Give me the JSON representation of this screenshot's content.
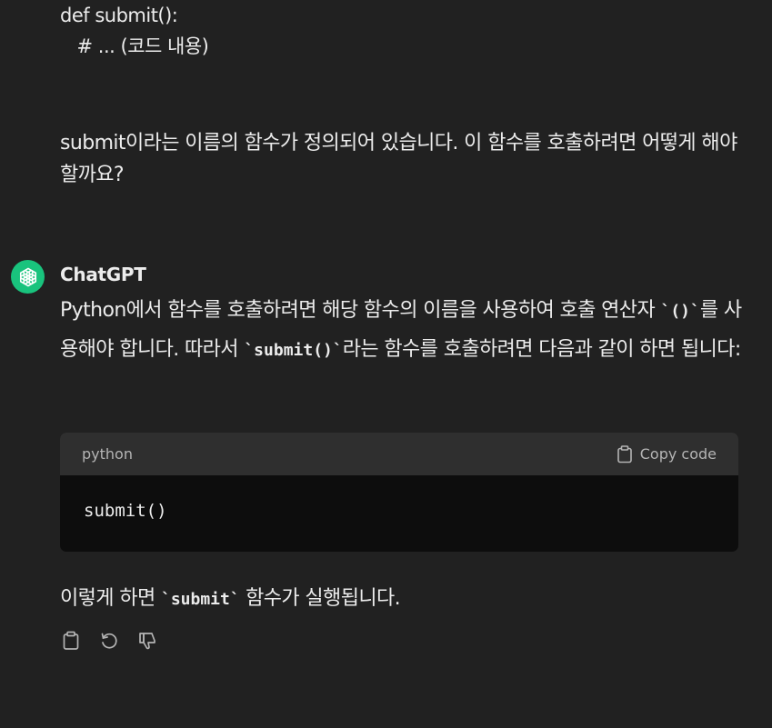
{
  "user_message": {
    "code_lines": [
      "def submit():",
      "   # ... (코드 내용)"
    ],
    "question": "submit이라는 이름의 함수가 정의되어 있습니다. 이 함수를 호출하려면 어떻게 해야 할까요?"
  },
  "assistant": {
    "author": "ChatGPT",
    "answer": {
      "part1": "Python에서 함수를 호출하려면 해당 함수의 이름을 사용하여 호출 연산자 ",
      "code1": "`()`",
      "part2": "를 사용해야 합니다. 따라서 ",
      "code2": "`submit()`",
      "part3": "라는 함수를 호출하려면 다음과 같이 하면 됩니다:"
    },
    "code_block": {
      "language": "python",
      "copy_label": "Copy code",
      "code": "submit()"
    },
    "after": {
      "part1": "이렇게 하면 ",
      "code": "`submit`",
      "part2": " 함수가 실행됩니다."
    }
  },
  "colors": {
    "background": "#212121",
    "avatar": "#19c37d",
    "code_header": "#2f2f2f",
    "code_body": "#0d0d0d"
  },
  "icons": [
    "openai-logo-icon",
    "clipboard-icon",
    "copy-icon",
    "regenerate-icon",
    "thumbs-down-icon"
  ]
}
